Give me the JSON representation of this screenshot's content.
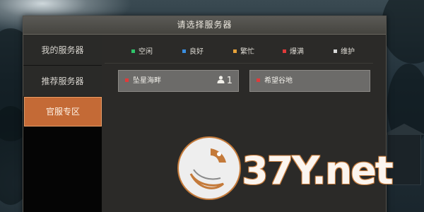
{
  "dialog": {
    "title": "请选择服务器"
  },
  "sidebar": {
    "items": [
      {
        "label": "我的服务器",
        "active": false
      },
      {
        "label": "推荐服务器",
        "active": false
      },
      {
        "label": "官服专区",
        "active": true
      }
    ]
  },
  "legend": [
    {
      "label": "空闲",
      "color": "#2fc46a"
    },
    {
      "label": "良好",
      "color": "#3a8ee0"
    },
    {
      "label": "繁忙",
      "color": "#e6a23a"
    },
    {
      "label": "爆满",
      "color": "#e03a3a"
    },
    {
      "label": "维护",
      "color": "#d8d8d8"
    }
  ],
  "servers": [
    {
      "name": "坠星海畔",
      "status_color": "#e03a3a",
      "count": "1",
      "icon": "user-icon"
    },
    {
      "name": "希望谷地",
      "status_color": "#e03a3a"
    }
  ],
  "watermark": {
    "text": "37Y.net"
  }
}
